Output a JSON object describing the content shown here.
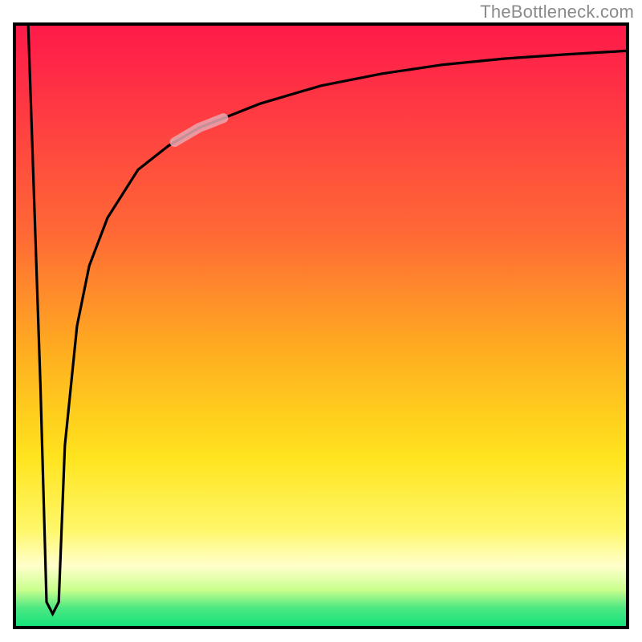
{
  "watermark": "TheBottleneck.com",
  "chart_data": {
    "type": "line",
    "title": "",
    "xlabel": "",
    "ylabel": "",
    "xlim": [
      0,
      100
    ],
    "ylim": [
      0,
      100
    ],
    "grid": false,
    "legend": false,
    "series": [
      {
        "name": "curve",
        "x": [
          2,
          4,
          5,
          6,
          7,
          8,
          10,
          12,
          15,
          20,
          25,
          30,
          35,
          40,
          50,
          60,
          70,
          80,
          90,
          100
        ],
        "y": [
          100,
          40,
          4,
          2,
          4,
          30,
          50,
          60,
          68,
          76,
          80,
          83,
          85,
          87,
          90,
          92,
          93.5,
          94.5,
          95.2,
          95.8
        ]
      }
    ],
    "gradient_stops": [
      {
        "pos": 0.0,
        "color": "#ff1a49"
      },
      {
        "pos": 0.1,
        "color": "#ff3045"
      },
      {
        "pos": 0.35,
        "color": "#ff6a35"
      },
      {
        "pos": 0.55,
        "color": "#ffb01f"
      },
      {
        "pos": 0.72,
        "color": "#ffe41e"
      },
      {
        "pos": 0.84,
        "color": "#fff76a"
      },
      {
        "pos": 0.9,
        "color": "#ffffcc"
      },
      {
        "pos": 0.94,
        "color": "#c9ff8d"
      },
      {
        "pos": 0.97,
        "color": "#4de882"
      },
      {
        "pos": 1.0,
        "color": "#16e27b"
      }
    ],
    "highlight_segment": {
      "x_range": [
        26,
        34
      ],
      "note": "pale pink thick stroke overlay on the curve"
    }
  }
}
